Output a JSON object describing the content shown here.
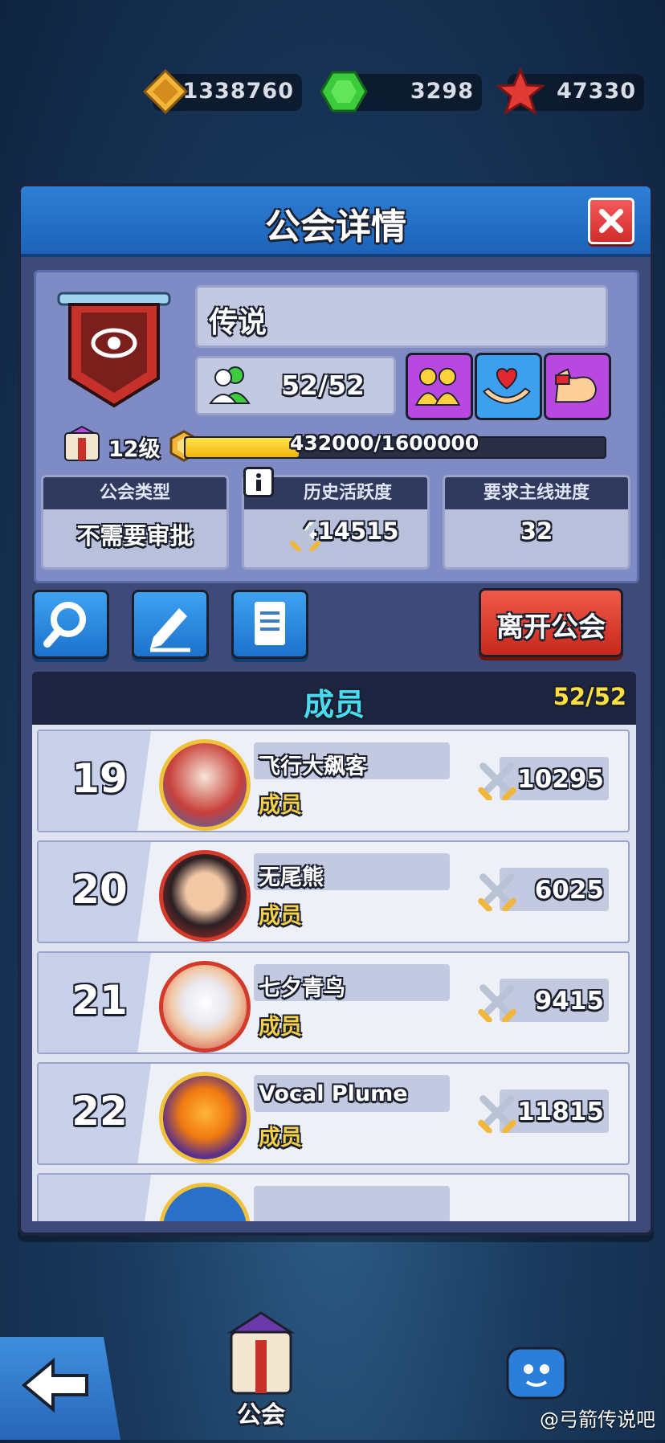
{
  "currencies": [
    {
      "icon": "diamond-coin-icon",
      "value": "1338760"
    },
    {
      "icon": "green-gem-icon",
      "value": "3298"
    },
    {
      "icon": "red-star-icon",
      "value": "47330"
    }
  ],
  "dialog": {
    "title": "公会详情",
    "close_icon": "close-icon"
  },
  "guild": {
    "name": "传说",
    "members": "52/52",
    "level": "12级",
    "xp": "432000/1600000",
    "xp_fraction": 0.27,
    "bonuses": [
      "friends-icon",
      "heart-hands-icon",
      "muscle-icon"
    ],
    "stats": {
      "type_label": "公会类型",
      "type_value": "不需要审批",
      "activity_label": "历史活跃度",
      "activity_value": "414515",
      "progress_label": "要求主线进度",
      "progress_value": "32"
    }
  },
  "actions": {
    "leave_label": "离开公会"
  },
  "member_list": {
    "title": "成员",
    "count": "52/52",
    "rows": [
      {
        "rank": "19",
        "name": "飞行大飙客",
        "role": "成员",
        "power": "10295"
      },
      {
        "rank": "20",
        "name": "无尾熊",
        "role": "成员",
        "power": "6025"
      },
      {
        "rank": "21",
        "name": "七夕青鸟",
        "role": "成员",
        "power": "9415"
      },
      {
        "rank": "22",
        "name": "Vocal Plume",
        "role": "成员",
        "power": "11815"
      }
    ]
  },
  "bottom_nav": {
    "guild_tab": "公会"
  },
  "watermark": "@弓箭传说吧"
}
